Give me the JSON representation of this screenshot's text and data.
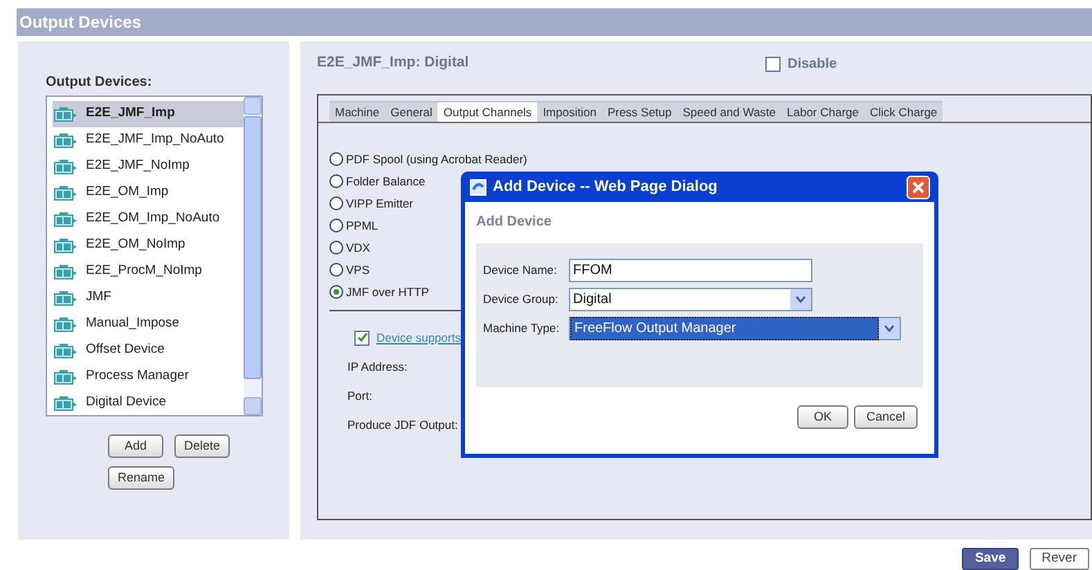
{
  "header": {
    "title": "Output Devices"
  },
  "device_list": {
    "label": "Output Devices:",
    "items": [
      {
        "name": "E2E_JMF_Imp",
        "selected": true
      },
      {
        "name": "E2E_JMF_Imp_NoAuto",
        "selected": false
      },
      {
        "name": "E2E_JMF_NoImp",
        "selected": false
      },
      {
        "name": "E2E_OM_Imp",
        "selected": false
      },
      {
        "name": "E2E_OM_Imp_NoAuto",
        "selected": false
      },
      {
        "name": "E2E_OM_NoImp",
        "selected": false
      },
      {
        "name": "E2E_ProcM_NoImp",
        "selected": false
      },
      {
        "name": "JMF",
        "selected": false
      },
      {
        "name": "Manual_Impose",
        "selected": false
      },
      {
        "name": "Offset Device",
        "selected": false
      },
      {
        "name": "Process Manager",
        "selected": false
      },
      {
        "name": "Digital Device",
        "selected": false
      }
    ],
    "buttons": [
      "Add",
      "Delete",
      "Rename"
    ]
  },
  "detail": {
    "title": "E2E_JMF_Imp: Digital",
    "disable": {
      "label": "Disable",
      "checked": false
    },
    "tabs": [
      {
        "label": "Machine",
        "selected": false
      },
      {
        "label": "General",
        "selected": false
      },
      {
        "label": "Output Channels",
        "selected": true
      },
      {
        "label": "Imposition",
        "selected": false
      },
      {
        "label": "Press Setup",
        "selected": false
      },
      {
        "label": "Speed and Waste",
        "selected": false
      },
      {
        "label": "Labor Charge",
        "selected": false
      },
      {
        "label": "Click Charge",
        "selected": false
      }
    ],
    "output_channels": [
      {
        "label": "PDF Spool (using Acrobat Reader)",
        "selected": false
      },
      {
        "label": "Folder Balance",
        "selected": false
      },
      {
        "label": "VIPP Emitter",
        "selected": false
      },
      {
        "label": "PPML",
        "selected": false
      },
      {
        "label": "VDX",
        "selected": false
      },
      {
        "label": "VPS",
        "selected": false
      },
      {
        "label": "JMF over HTTP",
        "selected": true
      }
    ],
    "device_supports": {
      "label": "Device supports",
      "checked": true
    },
    "fields": [
      "IP Address:",
      "Port:",
      "Produce JDF Output:"
    ]
  },
  "dialog": {
    "title": "Add Device -- Web Page Dialog",
    "heading": "Add Device",
    "fields": [
      {
        "kind": "text",
        "label": "Device Name:",
        "value": "FFOM",
        "focused": false
      },
      {
        "kind": "select",
        "label": "Device Group:",
        "value": "Digital",
        "focused": false
      },
      {
        "kind": "select",
        "label": "Machine Type:",
        "value": "FreeFlow Output Manager",
        "focused": true
      }
    ],
    "buttons": [
      "OK",
      "Cancel"
    ]
  },
  "footer_buttons": [
    {
      "label": "Save",
      "primary": true
    },
    {
      "label": "Rever",
      "primary": false
    }
  ]
}
